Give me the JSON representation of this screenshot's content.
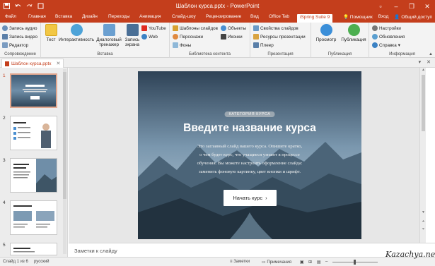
{
  "window": {
    "title": "Шаблон курса.pptx - PowerPoint",
    "qat_icons": [
      "save-icon",
      "undo-icon",
      "redo-icon",
      "customize-icon"
    ],
    "controls": [
      "minimize-icon",
      "restore-icon",
      "close-icon"
    ]
  },
  "tabs": {
    "file": "Файл",
    "items": [
      "Главная",
      "Вставка",
      "Дизайн",
      "Переходы",
      "Анимация",
      "Слайд-шоу",
      "Рецензирование",
      "Вид",
      "Office Tab"
    ],
    "active": "iSpring Suite 9",
    "help": "Помощник",
    "login": "Вход",
    "share": "Общий доступ"
  },
  "ribbon": {
    "accompaniment": {
      "label": "Сопровождение",
      "audio": "Запись аудио",
      "video": "Запись видео",
      "editor": "Редактор"
    },
    "insert": {
      "label": "Вставка",
      "quiz": "Тест",
      "interactivity": "Интерактивность",
      "dialog_l1": "Диалоговый",
      "dialog_l2": "тренажер",
      "screen_l1": "Запись",
      "screen_l2": "экрана",
      "youtube": "YouTube",
      "web": "Web"
    },
    "library": {
      "label": "Библиотека контента",
      "templates": "Шаблоны слайдов",
      "objects": "Объекты",
      "characters": "Персонажи",
      "icons": "Иконки",
      "backgrounds": "Фоны"
    },
    "presentation": {
      "label": "Презентация",
      "slide_props": "Свойства слайдов",
      "resources": "Ресурсы презентации",
      "player": "Плеер"
    },
    "publish": {
      "label": "Публикация",
      "preview": "Просмотр",
      "publish": "Публикация"
    },
    "info": {
      "label": "Информация",
      "settings": "Настройки",
      "updates": "Обновления",
      "help": "Справка"
    }
  },
  "doc_tab": {
    "name": "Шаблон курса.pptx"
  },
  "thumbnails": [
    {
      "number": "1",
      "selected": true
    },
    {
      "number": "2",
      "selected": false
    },
    {
      "number": "3",
      "selected": false
    },
    {
      "number": "4",
      "selected": false
    },
    {
      "number": "5",
      "selected": false
    }
  ],
  "slide": {
    "category": "КАТЕГОРИЯ КУРСА",
    "title": "Введите название курса",
    "body_lines": [
      "Это заглавный слайд вашего курса. Опишите кратко,",
      "о чем будет курс, что учащиеся узнают в процессе",
      "обучения. Вы можете настроить оформление слайда:",
      "заменить фоновую картинку, цвет кнопки и шрифт."
    ],
    "button": "Начать курс",
    "button_icon": "chevron-right-icon"
  },
  "notes": {
    "placeholder": "Заметки к слайду"
  },
  "status": {
    "slide_info": "Слайд 1 из 6",
    "language": "русский",
    "notes_btn": "Заметки",
    "comments_btn": "Примечания"
  },
  "watermark": "Kazachya.net",
  "colors": {
    "brand": "#c43e1c",
    "ribbon_bg": "#f3f3f3"
  }
}
